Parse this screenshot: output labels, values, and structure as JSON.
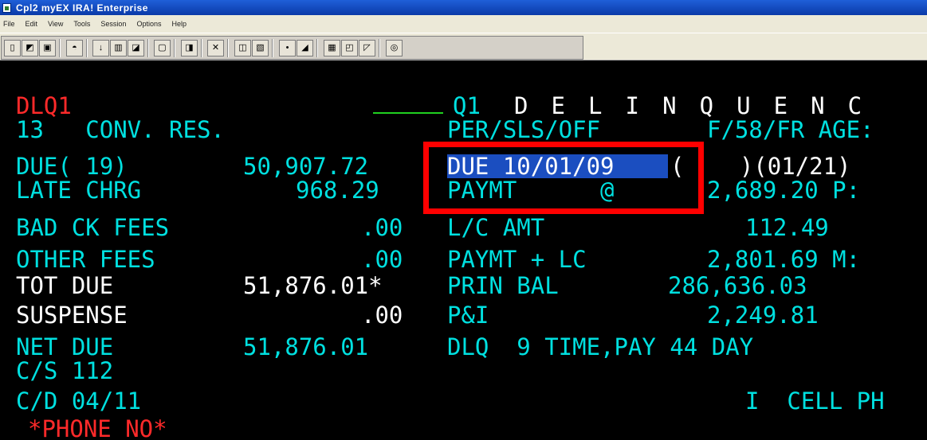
{
  "window": {
    "title": "Cpl2   myEX IRA! Enterprise"
  },
  "menu": [
    "File",
    "Edit",
    "View",
    "Tools",
    "Session",
    "Options",
    "Help"
  ],
  "toolbar": {
    "icons": [
      "new-session-icon",
      "open-icon",
      "save-icon",
      "print-icon",
      "record-icon",
      "macro-icon",
      "paste-icon",
      "view-icon",
      "folder-icon",
      "cut-icon",
      "copy-icon",
      "clipboard-icon",
      "send-icon",
      "receive-icon",
      "screen-icon",
      "display-icon",
      "chart-icon",
      "help-icon"
    ],
    "glyphs": [
      "▯",
      "◩",
      "▣",
      "◓",
      "↓",
      "▥",
      "◪",
      "▢",
      "◨",
      "✕",
      "◫",
      "▧",
      "•",
      "◢",
      "▦",
      "◰",
      "◸",
      "◎"
    ]
  },
  "terminal": {
    "screen_id": "DLQ1",
    "screen_code": "Q1",
    "screen_title": "D E L I N Q U E N C",
    "row2_left": "13   CONV. RES.",
    "row2_mid": "PER/SLS/OFF",
    "row2_right": "F/58/FR AGE:",
    "due_label": "DUE( 19)",
    "due_amount": "50,907.72",
    "due_date": "DUE 10/01/09",
    "due_paren_open": "(",
    "due_paren_rest": "    )(01/21)",
    "late_label": "LATE CHRG",
    "late_amount": "968.29",
    "paymt_label": "PAYMT      @",
    "paymt_amount": "2,689.20 P:",
    "badck_label": "BAD CK FEES",
    "badck_amount": ".00",
    "lc_label": "L/C AMT",
    "lc_amount": "112.49",
    "other_label": "OTHER FEES",
    "other_amount": ".00",
    "paylc_label": "PAYMT + LC",
    "paylc_amount": "2,801.69 M:",
    "totdue_label": "TOT DUE",
    "totdue_amount": "51,876.01*",
    "prin_label": "PRIN BAL",
    "prin_amount": "286,636.03",
    "susp_label": "SUSPENSE",
    "susp_amount": ".00",
    "pi_label": "P&I",
    "pi_amount": "2,249.81",
    "net_label": "NET DUE",
    "net_amount": "51,876.01",
    "dlq_text": "DLQ  9 TIME,PAY 44 DAY",
    "cs_text": "C/S 112",
    "cd_text": "C/D 04/11",
    "cell_text": "I  CELL PH",
    "phone_text": "*PHONE NO*"
  }
}
